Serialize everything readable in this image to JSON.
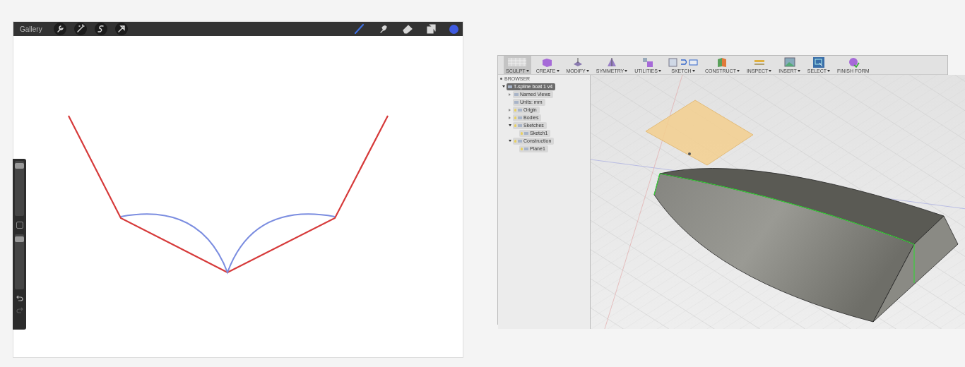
{
  "sketch_app": {
    "gallery": "Gallery",
    "left_tools": [
      {
        "kind": "wrench"
      },
      {
        "kind": "wand"
      },
      {
        "kind": "s"
      },
      {
        "kind": "arrow"
      }
    ],
    "right_tools": [
      {
        "kind": "brush",
        "selected": true
      },
      {
        "kind": "smudge",
        "selected": false
      },
      {
        "kind": "eraser",
        "selected": false
      },
      {
        "kind": "layers",
        "selected": false
      }
    ],
    "sidebar": {
      "size_slider": {
        "level": 0.96
      },
      "opacity_slider": {
        "level": 0.96
      }
    }
  },
  "cad_app": {
    "toolbar": [
      {
        "label": "SCULPT",
        "menu": true,
        "selected": true,
        "kind": "sculpt"
      },
      {
        "label": "CREATE",
        "menu": true,
        "selected": false,
        "kind": "cube"
      },
      {
        "label": "MODIFY",
        "menu": true,
        "selected": false,
        "kind": "modify"
      },
      {
        "label": "SYMMETRY",
        "menu": true,
        "selected": false,
        "kind": "symmetry"
      },
      {
        "label": "UTILITIES",
        "menu": true,
        "selected": false,
        "kind": "utilities"
      },
      {
        "label": "SKETCH",
        "menu": true,
        "selected": false,
        "kind": "sketch"
      },
      {
        "label": "CONSTRUCT",
        "menu": true,
        "selected": false,
        "kind": "construct"
      },
      {
        "label": "INSPECT",
        "menu": true,
        "selected": false,
        "kind": "inspect"
      },
      {
        "label": "INSERT",
        "menu": true,
        "selected": false,
        "kind": "insert"
      },
      {
        "label": "SELECT",
        "menu": true,
        "selected": false,
        "kind": "select"
      },
      {
        "label": "FINISH FORM",
        "menu": false,
        "selected": false,
        "kind": "finish"
      }
    ],
    "browser": {
      "title": "BROWSER",
      "tree": [
        {
          "label": "T-spline boat 1 v4",
          "expanded": true,
          "selected": true,
          "children": [
            {
              "label": "Named Views",
              "expanded": false,
              "selected": false
            },
            {
              "label": "Units: mm",
              "selected": false
            },
            {
              "label": "Origin",
              "expanded": false,
              "bulb": true,
              "selected": false
            },
            {
              "label": "Bodies",
              "expanded": false,
              "bulb": true,
              "selected": false
            },
            {
              "label": "Sketches",
              "expanded": true,
              "bulb": true,
              "selected": false,
              "children": [
                {
                  "label": "Sketch1",
                  "bulb": true,
                  "selected": false
                }
              ]
            },
            {
              "label": "Construction",
              "expanded": true,
              "bulb": true,
              "selected": false,
              "children": [
                {
                  "label": "Plane1",
                  "bulb": true,
                  "selected": false
                }
              ]
            }
          ]
        }
      ]
    }
  }
}
